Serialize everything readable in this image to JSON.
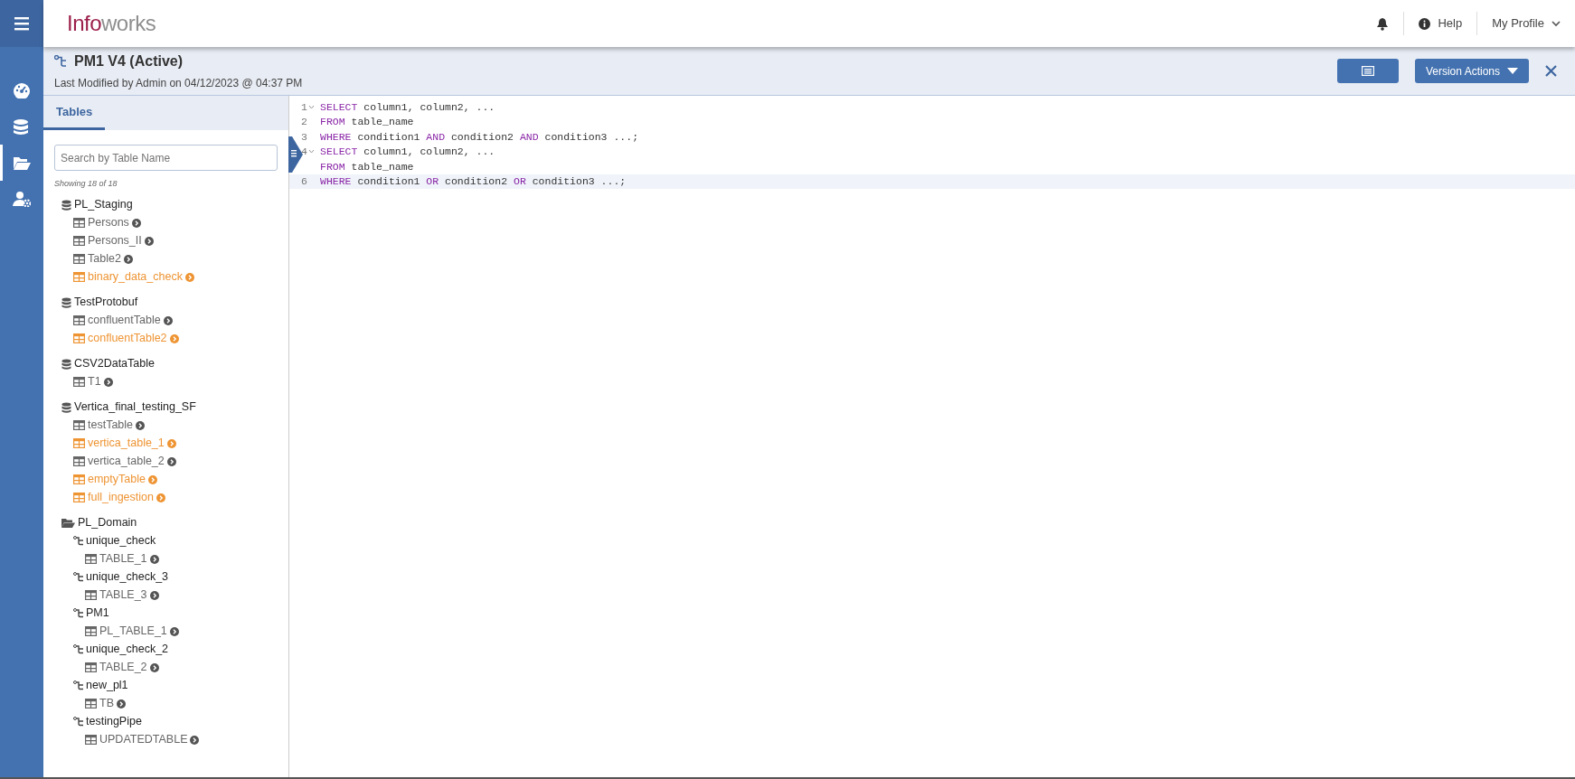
{
  "app": {
    "logo_primary": "Info",
    "logo_secondary": "works"
  },
  "header": {
    "help": "Help",
    "profile": "My Profile"
  },
  "nav": [
    {
      "kind": "dashboard",
      "selected": false
    },
    {
      "kind": "database",
      "selected": false
    },
    {
      "kind": "folder",
      "selected": true
    },
    {
      "kind": "user-settings",
      "selected": false
    }
  ],
  "pipeline": {
    "title": "PM1 V4 (Active)",
    "modified": "Last Modified by Admin on 04/12/2023 @ 04:37 PM",
    "version_button": "Version Actions"
  },
  "panel": {
    "tabs": [
      {
        "label": "Tables",
        "selected": true
      }
    ],
    "search": {
      "placeholder": "Search by Table Name"
    },
    "count": "Showing 18 of 18",
    "tree": [
      {
        "kind": "database",
        "label": "PL_Staging",
        "children": [
          {
            "kind": "table",
            "label": "Persons",
            "highlighted": false
          },
          {
            "kind": "table",
            "label": "Persons_II",
            "highlighted": false
          },
          {
            "kind": "table",
            "label": "Table2",
            "highlighted": false
          },
          {
            "kind": "table",
            "label": "binary_data_check",
            "highlighted": true
          }
        ]
      },
      {
        "kind": "database",
        "label": "TestProtobuf",
        "children": [
          {
            "kind": "table",
            "label": "confluentTable",
            "highlighted": false
          },
          {
            "kind": "table",
            "label": "confluentTable2",
            "highlighted": true
          }
        ]
      },
      {
        "kind": "database",
        "label": "CSV2DataTable",
        "children": [
          {
            "kind": "table",
            "label": "T1",
            "highlighted": false
          }
        ]
      },
      {
        "kind": "database",
        "label": "Vertica_final_testing_SF",
        "children": [
          {
            "kind": "table",
            "label": "testTable",
            "highlighted": false
          },
          {
            "kind": "table",
            "label": "vertica_table_1",
            "highlighted": true
          },
          {
            "kind": "table",
            "label": "vertica_table_2",
            "highlighted": false
          },
          {
            "kind": "table",
            "label": "emptyTable",
            "highlighted": true
          },
          {
            "kind": "table",
            "label": "full_ingestion",
            "highlighted": true
          }
        ]
      },
      {
        "kind": "folder",
        "label": "PL_Domain",
        "children": [
          {
            "kind": "pipeline",
            "label": "unique_check",
            "children": [
              {
                "kind": "table",
                "label": "TABLE_1",
                "highlighted": false
              }
            ]
          },
          {
            "kind": "pipeline",
            "label": "unique_check_3",
            "children": [
              {
                "kind": "table",
                "label": "TABLE_3",
                "highlighted": false
              }
            ]
          },
          {
            "kind": "pipeline",
            "label": "PM1",
            "children": [
              {
                "kind": "table",
                "label": "PL_TABLE_1",
                "highlighted": false
              }
            ]
          },
          {
            "kind": "pipeline",
            "label": "unique_check_2",
            "children": [
              {
                "kind": "table",
                "label": "TABLE_2",
                "highlighted": false
              }
            ]
          },
          {
            "kind": "pipeline",
            "label": "new_pl1",
            "children": [
              {
                "kind": "table",
                "label": "TB",
                "highlighted": false
              }
            ]
          },
          {
            "kind": "pipeline",
            "label": "testingPipe",
            "children": [
              {
                "kind": "table",
                "label": "UPDATEDTABLE",
                "highlighted": false
              }
            ]
          }
        ]
      }
    ]
  },
  "editor": {
    "lines": [
      {
        "number": "1",
        "foldable": true,
        "active": false,
        "segments": [
          {
            "kind": "keyword",
            "text": "SELECT"
          },
          {
            "kind": "plain",
            "text": " column1, column2, ..."
          }
        ]
      },
      {
        "number": "2",
        "foldable": false,
        "active": false,
        "segments": [
          {
            "kind": "keyword",
            "text": "FROM"
          },
          {
            "kind": "plain",
            "text": " table_name"
          }
        ]
      },
      {
        "number": "3",
        "foldable": false,
        "active": false,
        "segments": [
          {
            "kind": "keyword",
            "text": "WHERE"
          },
          {
            "kind": "plain",
            "text": " condition1 "
          },
          {
            "kind": "keyword",
            "text": "AND"
          },
          {
            "kind": "plain",
            "text": " condition2 "
          },
          {
            "kind": "keyword",
            "text": "AND"
          },
          {
            "kind": "plain",
            "text": " condition3 ...;"
          }
        ]
      },
      {
        "number": "4",
        "foldable": true,
        "active": false,
        "segments": [
          {
            "kind": "keyword",
            "text": "SELECT"
          },
          {
            "kind": "plain",
            "text": " column1, column2, ..."
          }
        ]
      },
      {
        "foldable": false,
        "active": false,
        "segments": [
          {
            "kind": "keyword",
            "text": "FROM"
          },
          {
            "kind": "plain",
            "text": " table_name"
          }
        ]
      },
      {
        "number": "6",
        "foldable": false,
        "active": true,
        "segments": [
          {
            "kind": "keyword",
            "text": "WHERE"
          },
          {
            "kind": "plain",
            "text": " condition1 "
          },
          {
            "kind": "keyword",
            "text": "OR"
          },
          {
            "kind": "plain",
            "text": " condition2 "
          },
          {
            "kind": "keyword",
            "text": "OR"
          },
          {
            "kind": "plain",
            "text": " condition3 ...;"
          }
        ]
      }
    ]
  }
}
